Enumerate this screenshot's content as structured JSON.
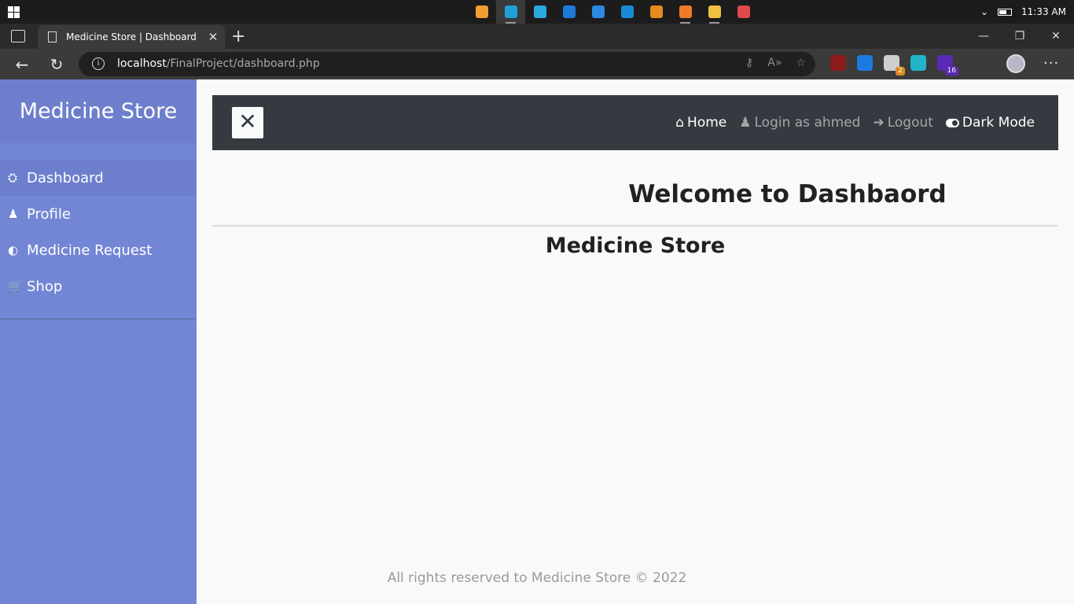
{
  "taskbar": {
    "clock": "11:33 AM",
    "tray_chevron": "⌄",
    "apps": [
      {
        "name": "taskview-app-icon",
        "color": "#f0a030",
        "active": false,
        "running": false
      },
      {
        "name": "edge-app-icon",
        "color": "#1fa0d6",
        "active": true,
        "running": true
      },
      {
        "name": "remote-app-icon",
        "color": "#2aa9e0",
        "active": false,
        "running": false
      },
      {
        "name": "monitor-app-icon",
        "color": "#1e7ad6",
        "active": false,
        "running": false
      },
      {
        "name": "screen-app-icon",
        "color": "#2b8ae0",
        "active": false,
        "running": false
      },
      {
        "name": "vscode-app-icon",
        "color": "#1a8ad6",
        "active": false,
        "running": false
      },
      {
        "name": "sublime-app-icon",
        "color": "#e58a1e",
        "active": false,
        "running": false
      },
      {
        "name": "xampp-app-icon",
        "color": "#f07a2a",
        "active": false,
        "running": true
      },
      {
        "name": "folder-app-icon",
        "color": "#f0c040",
        "active": false,
        "running": true
      },
      {
        "name": "paint-app-icon",
        "color": "#e04a4a",
        "active": false,
        "running": false
      }
    ]
  },
  "browser": {
    "tab_title": "Medicine Store | Dashboard",
    "tab_close": "✕",
    "new_tab": "+",
    "window_controls": {
      "minimize": "—",
      "restore": "❐",
      "close": "✕"
    },
    "back": "←",
    "refresh": "↻",
    "url_host": "localhost",
    "url_path": "/FinalProject/dashboard.php",
    "url_actions": {
      "key": "⚷",
      "read_aloud": "A»",
      "favorite": "☆"
    },
    "more": "···",
    "extensions": [
      {
        "name": "ublock-extension-icon",
        "color": "#8b1a1a",
        "badge": "",
        "badge_color": ""
      },
      {
        "name": "s-extension-icon",
        "color": "#1c7be0",
        "badge": "",
        "badge_color": ""
      },
      {
        "name": "cloud-extension-icon",
        "color": "#cfcfcf",
        "badge": "2",
        "badge_color": "#e08a1e"
      },
      {
        "name": "share-extension-icon",
        "color": "#22b5c8",
        "badge": "",
        "badge_color": ""
      },
      {
        "name": "puzzle-extension-icon",
        "color": "#5a2ab5",
        "badge": "16",
        "badge_color": "#5a2ab5"
      }
    ]
  },
  "sidebar": {
    "brand": "Medicine Store",
    "items": [
      {
        "label": "Dashboard",
        "icon": "⛭",
        "icon_name": "dashboard-icon",
        "active": true
      },
      {
        "label": "Profile",
        "icon": "♟",
        "icon_name": "user-icon",
        "active": false
      },
      {
        "label": "Medicine Request",
        "icon": "◐",
        "icon_name": "pills-icon",
        "active": false
      },
      {
        "label": "Shop",
        "icon": "🛒",
        "icon_name": "cart-icon",
        "active": false
      }
    ]
  },
  "topnav": {
    "close_symbol": "✕",
    "home": {
      "icon": "⌂",
      "label": "Home"
    },
    "login": {
      "icon": "♟",
      "label": "Login as ahmed"
    },
    "logout": {
      "icon": "➜",
      "label": "Logout"
    },
    "dark_mode": {
      "label": "Dark Mode"
    }
  },
  "main": {
    "welcome": "Welcome to Dashbaord",
    "subtitle": "Medicine Store",
    "footer": "All rights reserved to Medicine Store © 2022"
  },
  "colors": {
    "sidebar": "#7386d5",
    "sidebar_active": "#6d7fcc",
    "navbar": "#343a40",
    "page_bg": "#f9f9f9"
  }
}
